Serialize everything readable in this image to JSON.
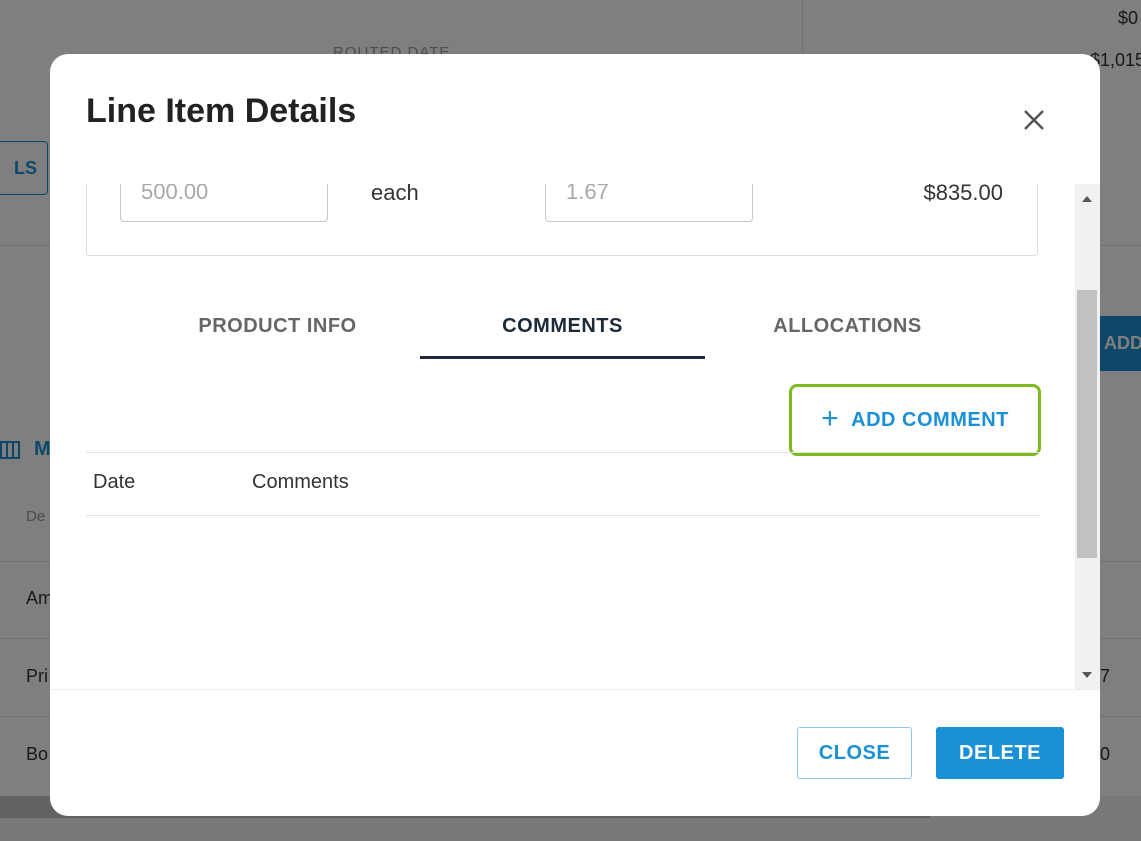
{
  "background": {
    "top_right_value_1": "$0",
    "top_right_value_2": "$1,015",
    "column_header": "ROUTED DATE",
    "partial_button": "LS",
    "partial_add_button": "ADD",
    "partial_section_label": "M",
    "partial_row_1": "De",
    "partial_row_2": "Am",
    "partial_row_3": "Pri",
    "partial_row_4": "Bo",
    "right_cut_1": "7",
    "right_cut_2": "0"
  },
  "modal": {
    "title": "Line Item Details",
    "quantity_value": "500.00",
    "unit": "each",
    "unit_price_value": "1.67",
    "line_total": "$835.00",
    "tabs": [
      {
        "label": "PRODUCT INFO",
        "active": false
      },
      {
        "label": "COMMENTS",
        "active": true
      },
      {
        "label": "ALLOCATIONS",
        "active": false
      }
    ],
    "add_comment_label": "ADD COMMENT",
    "table_columns": [
      "Date",
      "Comments"
    ],
    "footer": {
      "close_label": "CLOSE",
      "delete_label": "DELETE"
    }
  },
  "colors": {
    "accent": "#1a90d6",
    "highlight_outline": "#7fb921",
    "active_tab": "#1d2a3a"
  },
  "icons": {
    "close": "close-icon",
    "add": "plus-icon",
    "columns": "columns-icon"
  }
}
